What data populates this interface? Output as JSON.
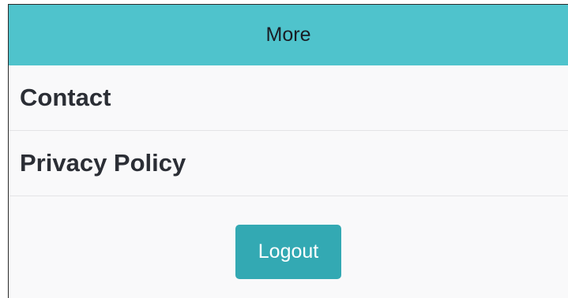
{
  "header": {
    "title": "More"
  },
  "menu": {
    "items": [
      {
        "label": "Contact"
      },
      {
        "label": "Privacy Policy"
      }
    ]
  },
  "actions": {
    "logout_label": "Logout"
  },
  "colors": {
    "header_bg": "#4fc3cc",
    "button_bg": "#33a9b3",
    "list_bg": "#f9f9fa"
  }
}
